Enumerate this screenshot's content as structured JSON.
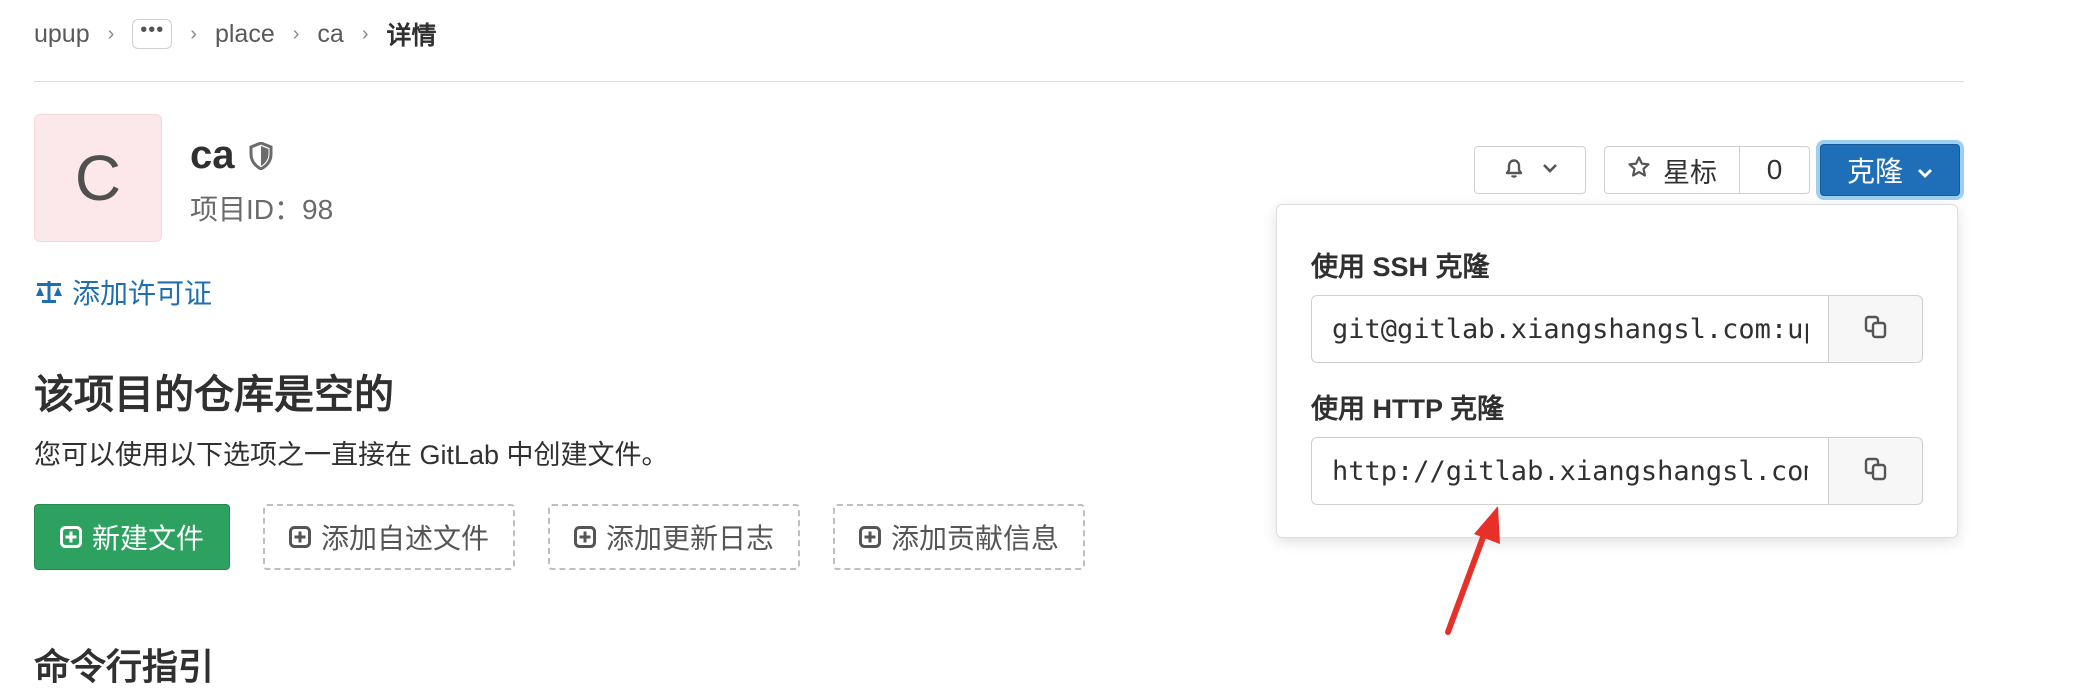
{
  "breadcrumb": {
    "items": [
      "upup",
      "place",
      "ca"
    ],
    "ellipsis": "•••",
    "current": "详情",
    "separator": "›"
  },
  "project": {
    "avatar_letter": "C",
    "name": "ca",
    "id_label": "项目ID：98"
  },
  "license_link": "添加许可证",
  "empty_repo": {
    "title": "该项目的仓库是空的",
    "description": "您可以使用以下选项之一直接在 GitLab 中创建文件。"
  },
  "actions": {
    "new_file": "新建文件",
    "add_readme": "添加自述文件",
    "add_changelog": "添加更新日志",
    "add_contributing": "添加贡献信息"
  },
  "cli_title": "命令行指引",
  "toolbar": {
    "star_label": "星标",
    "star_count": "0",
    "clone_label": "克隆"
  },
  "clone_dropdown": {
    "ssh_label": "使用 SSH 克隆",
    "ssh_value": "git@gitlab.xiangshangsl.com:upup/place/ca.git",
    "http_label": "使用 HTTP 克隆",
    "http_value": "http://gitlab.xiangshangsl.com/upup/place/ca.git"
  },
  "colors": {
    "primary_green": "#2da160",
    "clone_blue": "#1f6fb8",
    "link_blue": "#1f6fb0",
    "avatar_bg": "#fce8ea",
    "annotation_red": "#e8302a"
  }
}
